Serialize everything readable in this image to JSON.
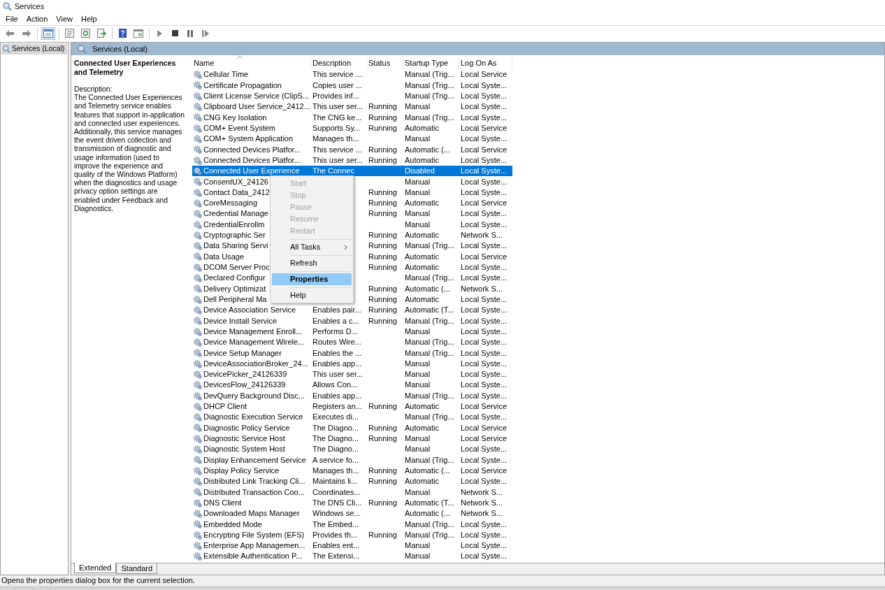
{
  "window": {
    "title": "Services"
  },
  "menubar": [
    "File",
    "Action",
    "View",
    "Help"
  ],
  "toolbar": [
    {
      "kind": "back"
    },
    {
      "kind": "forward"
    },
    {
      "kind": "separator"
    },
    {
      "kind": "tree",
      "selected": true
    },
    {
      "kind": "separator"
    },
    {
      "kind": "sheet",
      "selected": false
    },
    {
      "kind": "refresh",
      "selected": false
    },
    {
      "kind": "export",
      "selected": false
    },
    {
      "kind": "separator"
    },
    {
      "kind": "help",
      "selected": false
    },
    {
      "kind": "panel",
      "selected": false
    },
    {
      "kind": "separator"
    },
    {
      "kind": "play"
    },
    {
      "kind": "stop"
    },
    {
      "kind": "pause"
    },
    {
      "kind": "resume"
    }
  ],
  "tree": [
    {
      "label": "Services (Local)",
      "selected": true
    }
  ],
  "pane": {
    "title": "Services (Local)"
  },
  "details": {
    "title": "Connected User Experiences and Telemetry",
    "label": "Description:",
    "text": "The Connected User Experiences and Telemetry service enables features that support in-application and connected user experiences. Additionally, this service manages the event driven collection and transmission of diagnostic and usage information (used to improve the experience and quality of the Windows Platform) when the diagnostics and usage privacy option settings are enabled under Feedback and Diagnostics."
  },
  "table": {
    "columns": [
      {
        "label": "Name",
        "sorted": true
      },
      {
        "label": "Description",
        "sorted": false
      },
      {
        "label": "Status",
        "sorted": false
      },
      {
        "label": "Startup Type",
        "sorted": false
      },
      {
        "label": "Log On As",
        "sorted": false
      }
    ],
    "rows": [
      {
        "name": "Cellular Time",
        "description": "This service ...",
        "startup": "Manual (Trig...",
        "logon": "Local Service",
        "selected": false
      },
      {
        "name": "Certificate Propagation",
        "description": "Copies user ...",
        "startup": "Manual (Trig...",
        "logon": "Local Syste...",
        "selected": false
      },
      {
        "name": "Client License Service (ClipS...",
        "description": "Provides inf...",
        "startup": "Manual (Trig...",
        "logon": "Local Syste...",
        "selected": false
      },
      {
        "name": "Clipboard User Service_2412...",
        "description": "This user ser...",
        "status": "Running",
        "startup": "Manual",
        "logon": "Local Syste...",
        "selected": false
      },
      {
        "name": "CNG Key Isolation",
        "description": "The CNG ke...",
        "status": "Running",
        "startup": "Manual (Trig...",
        "logon": "Local Syste...",
        "selected": false
      },
      {
        "name": "COM+ Event System",
        "description": "Supports Sy...",
        "status": "Running",
        "startup": "Automatic",
        "logon": "Local Service",
        "selected": false
      },
      {
        "name": "COM+ System Application",
        "description": "Manages th...",
        "startup": "Manual",
        "logon": "Local Syste...",
        "selected": false
      },
      {
        "name": "Connected Devices Platfor...",
        "description": "This service ...",
        "status": "Running",
        "startup": "Automatic (...",
        "logon": "Local Service",
        "selected": false
      },
      {
        "name": "Connected Devices Platfor...",
        "description": "This user ser...",
        "status": "Running",
        "startup": "Automatic",
        "logon": "Local Syste...",
        "selected": false
      },
      {
        "name": "Connected User Experience",
        "description": "The Connec",
        "startup": "Disabled",
        "logon": "Local Syste...",
        "selected": true
      },
      {
        "name": "ConsentUX_24126",
        "startup": "Manual",
        "logon": "Local Syste...",
        "selected": false
      },
      {
        "name": "Contact Data_2412",
        "status": "Running",
        "startup": "Manual",
        "logon": "Local Syste...",
        "selected": false
      },
      {
        "name": "CoreMessaging",
        "status": "Running",
        "startup": "Automatic",
        "logon": "Local Service",
        "selected": false
      },
      {
        "name": "Credential Manage",
        "status": "Running",
        "startup": "Manual",
        "logon": "Local Syste...",
        "selected": false
      },
      {
        "name": "CredentialEnrollm",
        "startup": "Manual",
        "logon": "Local Syste...",
        "selected": false
      },
      {
        "name": "Cryptographic Ser",
        "status": "Running",
        "startup": "Automatic",
        "logon": "Network S...",
        "selected": false
      },
      {
        "name": "Data Sharing Servi",
        "status": "Running",
        "startup": "Manual (Trig...",
        "logon": "Local Syste...",
        "selected": false
      },
      {
        "name": "Data Usage",
        "status": "Running",
        "startup": "Automatic",
        "logon": "Local Service",
        "selected": false
      },
      {
        "name": "DCOM Server Proc",
        "status": "Running",
        "startup": "Automatic",
        "logon": "Local Syste...",
        "selected": false
      },
      {
        "name": "Declared Configur",
        "startup": "Manual (Trig...",
        "logon": "Local Syste...",
        "selected": false
      },
      {
        "name": "Delivery Optimizat",
        "status": "Running",
        "startup": "Automatic (...",
        "logon": "Network S...",
        "selected": false
      },
      {
        "name": "Dell Peripheral Ma",
        "status": "Running",
        "startup": "Automatic",
        "logon": "Local Syste...",
        "selected": false
      },
      {
        "name": "Device Association Service",
        "description": "Enables pair...",
        "status": "Running",
        "startup": "Automatic (T...",
        "logon": "Local Syste...",
        "selected": false
      },
      {
        "name": "Device Install Service",
        "description": "Enables a c...",
        "status": "Running",
        "startup": "Manual (Trig...",
        "logon": "Local Syste...",
        "selected": false
      },
      {
        "name": "Device Management Enroll...",
        "description": "Performs D...",
        "startup": "Manual",
        "logon": "Local Syste...",
        "selected": false
      },
      {
        "name": "Device Management Wirele...",
        "description": "Routes Wire...",
        "startup": "Manual (Trig...",
        "logon": "Local Syste...",
        "selected": false
      },
      {
        "name": "Device Setup Manager",
        "description": "Enables the ...",
        "startup": "Manual (Trig...",
        "logon": "Local Syste...",
        "selected": false
      },
      {
        "name": "DeviceAssociationBroker_24...",
        "description": "Enables app...",
        "startup": "Manual",
        "logon": "Local Syste...",
        "selected": false
      },
      {
        "name": "DevicePicker_24126339",
        "description": "This user ser...",
        "startup": "Manual",
        "logon": "Local Syste...",
        "selected": false
      },
      {
        "name": "DevicesFlow_24126339",
        "description": "Allows Con...",
        "startup": "Manual",
        "logon": "Local Syste...",
        "selected": false
      },
      {
        "name": "DevQuery Background Disc...",
        "description": "Enables app...",
        "startup": "Manual (Trig...",
        "logon": "Local Syste...",
        "selected": false
      },
      {
        "name": "DHCP Client",
        "description": "Registers an...",
        "status": "Running",
        "startup": "Automatic",
        "logon": "Local Service",
        "selected": false
      },
      {
        "name": "Diagnostic Execution Service",
        "description": "Executes di...",
        "startup": "Manual (Trig...",
        "logon": "Local Syste...",
        "selected": false
      },
      {
        "name": "Diagnostic Policy Service",
        "description": "The Diagno...",
        "status": "Running",
        "startup": "Automatic",
        "logon": "Local Service",
        "selected": false
      },
      {
        "name": "Diagnostic Service Host",
        "description": "The Diagno...",
        "status": "Running",
        "startup": "Manual",
        "logon": "Local Service",
        "selected": false
      },
      {
        "name": "Diagnostic System Host",
        "description": "The Diagno...",
        "startup": "Manual",
        "logon": "Local Syste...",
        "selected": false
      },
      {
        "name": "Display Enhancement Service",
        "description": "A service fo...",
        "startup": "Manual (Trig...",
        "logon": "Local Syste...",
        "selected": false
      },
      {
        "name": "Display Policy Service",
        "description": "Manages th...",
        "status": "Running",
        "startup": "Automatic (...",
        "logon": "Local Service",
        "selected": false
      },
      {
        "name": "Distributed Link Tracking Cli...",
        "description": "Maintains li...",
        "status": "Running",
        "startup": "Automatic",
        "logon": "Local Syste...",
        "selected": false
      },
      {
        "name": "Distributed Transaction Coo...",
        "description": "Coordinates...",
        "startup": "Manual",
        "logon": "Network S...",
        "selected": false
      },
      {
        "name": "DNS Client",
        "description": "The DNS Cli...",
        "status": "Running",
        "startup": "Automatic (T...",
        "logon": "Network S...",
        "selected": false
      },
      {
        "name": "Downloaded Maps Manager",
        "description": "Windows se...",
        "startup": "Automatic (...",
        "logon": "Network S...",
        "selected": false
      },
      {
        "name": "Embedded Mode",
        "description": "The Embed...",
        "startup": "Manual (Trig...",
        "logon": "Local Syste...",
        "selected": false
      },
      {
        "name": "Encrypting File System (EFS)",
        "description": "Provides th...",
        "status": "Running",
        "startup": "Manual (Trig...",
        "logon": "Local Syste...",
        "selected": false
      },
      {
        "name": "Enterprise App Managemen...",
        "description": "Enables ent...",
        "startup": "Manual",
        "logon": "Local Syste...",
        "selected": false
      },
      {
        "name": "Extensible Authentication P...",
        "description": "The Extensi...",
        "startup": "Manual",
        "logon": "Local Syste...",
        "selected": false
      }
    ]
  },
  "context_menu": [
    {
      "kind": "item",
      "label": "Start",
      "disabled": true,
      "selected": false
    },
    {
      "kind": "item",
      "label": "Stop",
      "disabled": true,
      "selected": false
    },
    {
      "kind": "item",
      "label": "Pause",
      "disabled": true,
      "selected": false
    },
    {
      "kind": "item",
      "label": "Resume",
      "disabled": true,
      "selected": false
    },
    {
      "kind": "item",
      "label": "Restart",
      "disabled": true,
      "selected": false
    },
    {
      "kind": "separator"
    },
    {
      "kind": "submenu",
      "label": "All Tasks",
      "disabled": false,
      "selected": false
    },
    {
      "kind": "separator"
    },
    {
      "kind": "item",
      "label": "Refresh",
      "disabled": false,
      "selected": false
    },
    {
      "kind": "separator"
    },
    {
      "kind": "default",
      "label": "Properties",
      "disabled": false,
      "selected": true
    },
    {
      "kind": "separator"
    },
    {
      "kind": "item",
      "label": "Help",
      "disabled": false,
      "selected": false
    }
  ],
  "view_tabs": [
    {
      "label": "Extended",
      "selected": true
    },
    {
      "label": "Standard",
      "selected": false
    }
  ],
  "status_bar": "Opens the properties dialog box for the current selection."
}
